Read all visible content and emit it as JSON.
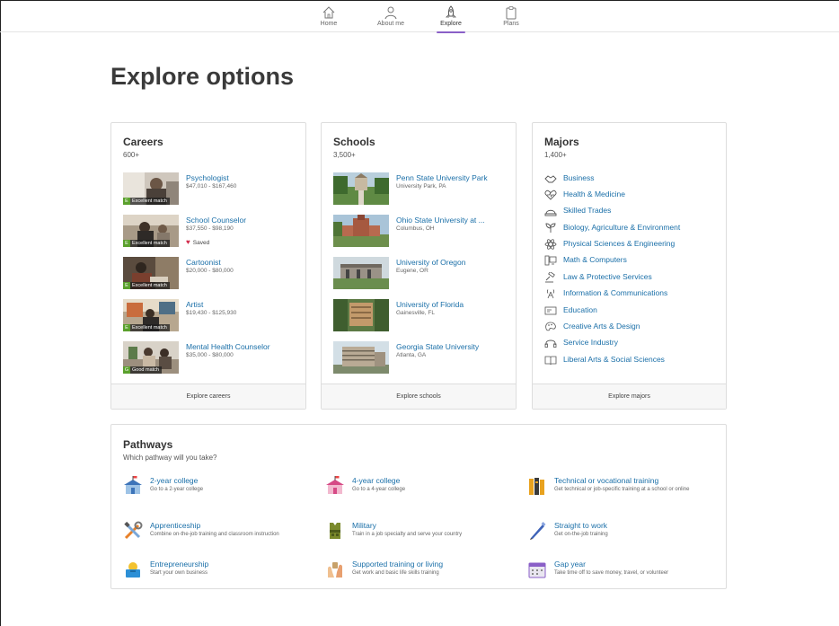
{
  "nav": {
    "items": [
      {
        "label": "Home",
        "icon": "home-icon"
      },
      {
        "label": "About me",
        "icon": "person-icon"
      },
      {
        "label": "Explore",
        "icon": "rocket-icon"
      },
      {
        "label": "Plans",
        "icon": "clipboard-icon"
      }
    ],
    "active": "Explore",
    "accent_color": "#8a5fc7"
  },
  "page": {
    "title": "Explore options"
  },
  "careers": {
    "heading": "Careers",
    "count": "600+",
    "items": [
      {
        "title": "Psychologist",
        "salary": "$47,010 - $167,460",
        "match_level": "E",
        "match": "Excellent match",
        "saved": ""
      },
      {
        "title": "School Counselor",
        "salary": "$37,550 - $98,190",
        "match_level": "E",
        "match": "Excellent match",
        "saved": "Saved"
      },
      {
        "title": "Cartoonist",
        "salary": "$20,000 - $80,000",
        "match_level": "E",
        "match": "Excellent match",
        "saved": ""
      },
      {
        "title": "Artist",
        "salary": "$19,430 - $125,930",
        "match_level": "E",
        "match": "Excellent match",
        "saved": ""
      },
      {
        "title": "Mental Health Counselor",
        "salary": "$35,000 - $80,000",
        "match_level": "G",
        "match": "Good match",
        "saved": ""
      }
    ],
    "footer": "Explore careers"
  },
  "schools": {
    "heading": "Schools",
    "count": "3,500+",
    "items": [
      {
        "title": "Penn State University Park",
        "location": "University Park, PA"
      },
      {
        "title": "Ohio State University at ...",
        "location": "Columbus, OH"
      },
      {
        "title": "University of Oregon",
        "location": "Eugene, OR"
      },
      {
        "title": "University of Florida",
        "location": "Gainesville, FL"
      },
      {
        "title": "Georgia State University",
        "location": "Atlanta, GA"
      }
    ],
    "footer": "Explore schools"
  },
  "majors": {
    "heading": "Majors",
    "count": "1,400+",
    "items": [
      {
        "label": "Business",
        "icon": "handshake-icon"
      },
      {
        "label": "Health & Medicine",
        "icon": "heart-pulse-icon"
      },
      {
        "label": "Skilled Trades",
        "icon": "hard-hat-icon"
      },
      {
        "label": "Biology, Agriculture & Environment",
        "icon": "plant-icon"
      },
      {
        "label": "Physical Sciences & Engineering",
        "icon": "atom-icon"
      },
      {
        "label": "Math & Computers",
        "icon": "computer-icon"
      },
      {
        "label": "Law & Protective Services",
        "icon": "gavel-icon"
      },
      {
        "label": "Information & Communications",
        "icon": "antenna-icon"
      },
      {
        "label": "Education",
        "icon": "chalkboard-icon"
      },
      {
        "label": "Creative Arts & Design",
        "icon": "palette-icon"
      },
      {
        "label": "Service Industry",
        "icon": "headset-icon"
      },
      {
        "label": "Liberal Arts & Social Sciences",
        "icon": "book-icon"
      }
    ],
    "footer": "Explore majors"
  },
  "pathways": {
    "heading": "Pathways",
    "subtitle": "Which pathway will you take?",
    "items": [
      {
        "title": "2-year college",
        "desc": "Go to a 2-year college",
        "icon": "school-building-icon"
      },
      {
        "title": "4-year college",
        "desc": "Go to a 4-year college",
        "icon": "university-building-icon"
      },
      {
        "title": "Technical or vocational training",
        "desc": "Get technical or job-specific training at a school or online",
        "icon": "books-icon"
      },
      {
        "title": "Apprenticeship",
        "desc": "Combine on-the-job training and classroom instruction",
        "icon": "tools-icon"
      },
      {
        "title": "Military",
        "desc": "Train in a job specialty and serve your country",
        "icon": "vest-icon"
      },
      {
        "title": "Straight to work",
        "desc": "Get on-the-job training",
        "icon": "pen-icon"
      },
      {
        "title": "Entrepreneurship",
        "desc": "Start your own business",
        "icon": "bulb-icon"
      },
      {
        "title": "Supported training or living",
        "desc": "Get work and basic life skills training",
        "icon": "hands-icon"
      },
      {
        "title": "Gap year",
        "desc": "Take time off to save money, travel, or volunteer",
        "icon": "calendar-icon"
      }
    ]
  },
  "colors": {
    "link": "#1a6fa8",
    "heading": "#3a3a3a",
    "match_excellent": "#5aa02c",
    "saved_heart": "#d22a4a"
  }
}
